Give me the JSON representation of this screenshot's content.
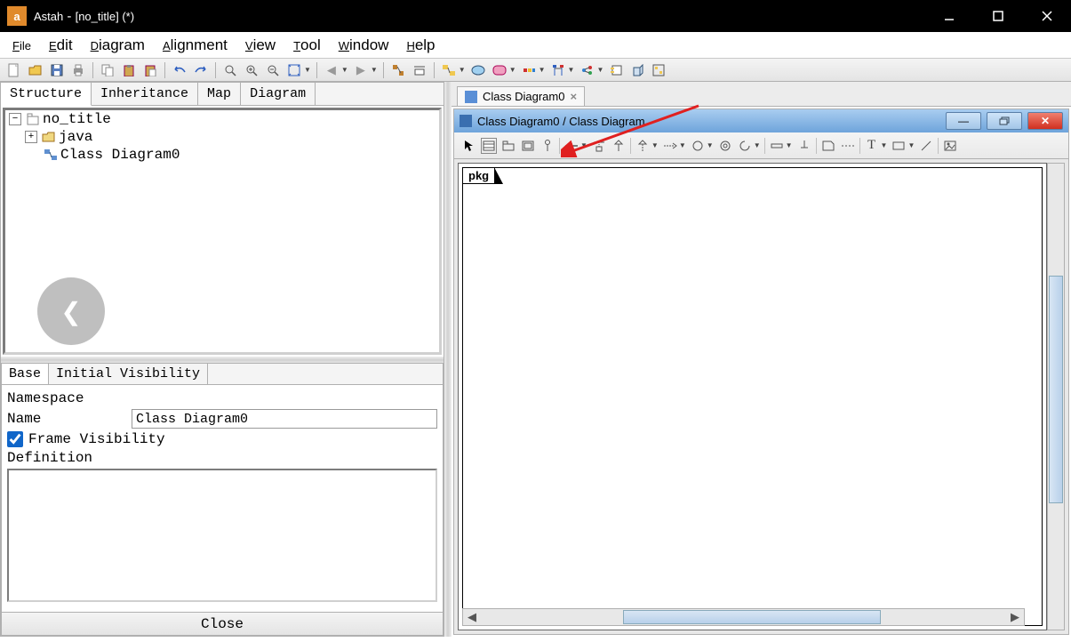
{
  "window": {
    "app": "Astah",
    "doc": "[no_title] (*)"
  },
  "menu": [
    "File",
    "Edit",
    "Diagram",
    "Alignment",
    "View",
    "Tool",
    "Window",
    "Help"
  ],
  "leftTabs": [
    "Structure",
    "Inheritance",
    "Map",
    "Diagram"
  ],
  "tree": {
    "root": "no_title",
    "child1": "java",
    "child2": "Class Diagram0"
  },
  "propTabs": [
    "Base",
    "Initial Visibility"
  ],
  "props": {
    "namespaceLabel": "Namespace",
    "nameLabel": "Name",
    "nameValue": "Class Diagram0",
    "frameVisLabel": "Frame Visibility",
    "frameVisChecked": true,
    "definitionLabel": "Definition",
    "closeLabel": "Close"
  },
  "docTab": {
    "label": "Class Diagram0"
  },
  "childWin": {
    "title": "Class Diagram0 / Class Diagram"
  },
  "canvas": {
    "pkgLabel": "pkg"
  }
}
